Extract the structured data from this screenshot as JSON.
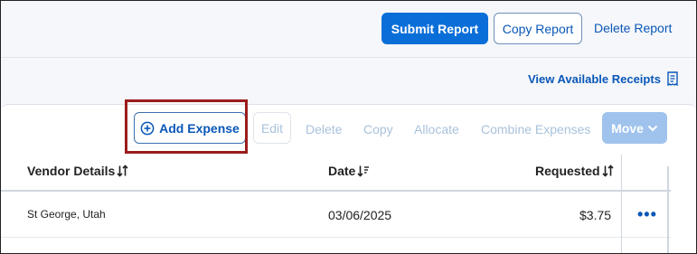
{
  "header": {
    "submit_label": "Submit Report",
    "copy_label": "Copy Report",
    "delete_label": "Delete Report",
    "receipts_label": "View Available Receipts"
  },
  "toolbar": {
    "add_expense_label": "Add Expense",
    "edit_label": "Edit",
    "delete_label": "Delete",
    "copy_label": "Copy",
    "allocate_label": "Allocate",
    "combine_label": "Combine Expenses",
    "move_label": "Move"
  },
  "table": {
    "columns": {
      "vendor": "Vendor Details",
      "date": "Date",
      "requested": "Requested"
    },
    "rows": [
      {
        "vendor": "St George, Utah",
        "date": "03/06/2025",
        "requested": "$3.75",
        "more": "•••"
      }
    ]
  },
  "colors": {
    "primary": "#0a6ed8",
    "link": "#0a57b8",
    "disabled": "#a9c2dc",
    "highlight": "#9b1c1c"
  }
}
